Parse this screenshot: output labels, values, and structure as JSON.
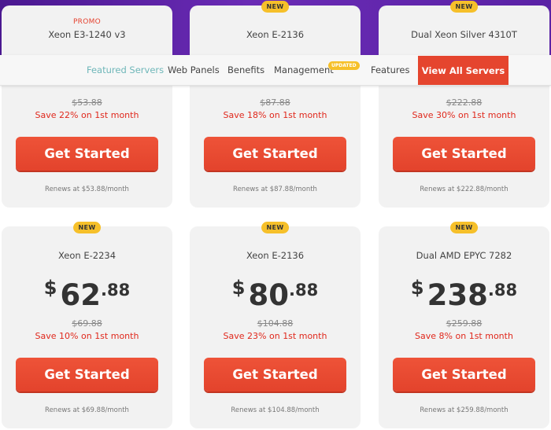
{
  "nav": {
    "items": [
      "Featured Servers",
      "Web Panels",
      "Benefits",
      "Management",
      "Features"
    ],
    "updated_badge": "UPDATED",
    "cta": "View All Servers"
  },
  "colors": {
    "accent": "#e5452e",
    "badge": "#f6c02a",
    "active_nav": "#6fb7b9",
    "background_top": "#5b1fa0"
  },
  "cards_top": [
    {
      "badge": "",
      "promo": "PROMO",
      "title": "Xeon E3-1240 v3",
      "old_price": "$53.88",
      "save": "Save 22% on 1st month",
      "cta": "Get Started",
      "renews": "Renews at $53.88/month"
    },
    {
      "badge": "NEW",
      "promo": "",
      "title": "Xeon E-2136",
      "old_price": "$87.88",
      "save": "Save 18% on 1st month",
      "cta": "Get Started",
      "renews": "Renews at $87.88/month"
    },
    {
      "badge": "NEW",
      "promo": "",
      "title": "Dual Xeon Silver 4310T",
      "old_price": "$222.88",
      "save": "Save 30% on 1st month",
      "cta": "Get Started",
      "renews": "Renews at $222.88/month"
    }
  ],
  "cards_bottom": [
    {
      "badge": "NEW",
      "title": "Xeon E-2234",
      "currency": "$",
      "price_whole": "62",
      "price_cents": ".88",
      "old_price": "$69.88",
      "save": "Save 10% on 1st month",
      "cta": "Get Started",
      "renews": "Renews at $69.88/month"
    },
    {
      "badge": "NEW",
      "title": "Xeon E-2136",
      "currency": "$",
      "price_whole": "80",
      "price_cents": ".88",
      "old_price": "$104.88",
      "save": "Save 23% on 1st month",
      "cta": "Get Started",
      "renews": "Renews at $104.88/month"
    },
    {
      "badge": "NEW",
      "title": "Dual AMD EPYC 7282",
      "currency": "$",
      "price_whole": "238",
      "price_cents": ".88",
      "old_price": "$259.88",
      "save": "Save 8% on 1st month",
      "cta": "Get Started",
      "renews": "Renews at $259.88/month"
    }
  ]
}
